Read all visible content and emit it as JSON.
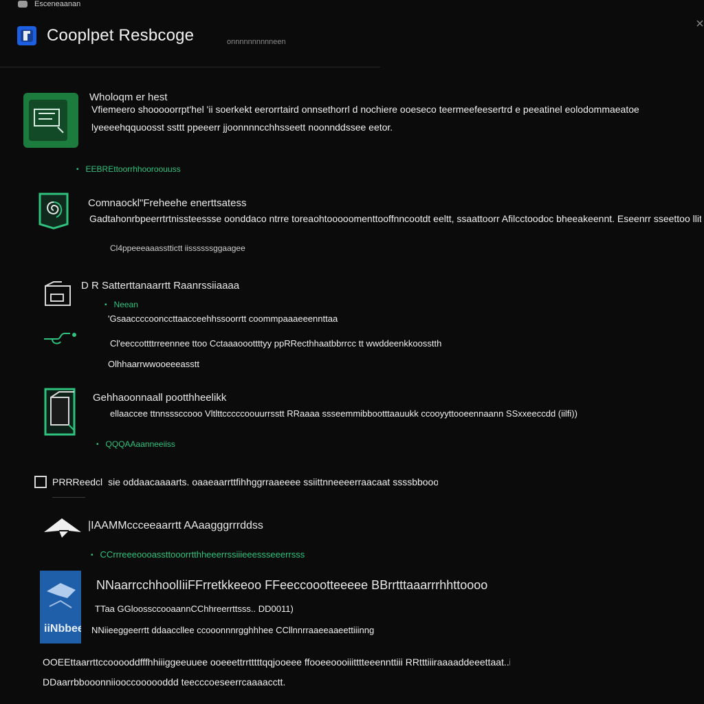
{
  "top": {
    "text": "Esceneaanan"
  },
  "header": {
    "title": "Cooplpet Resbcoge",
    "subtitle": "onnnnnnnnnneen"
  },
  "sections": [
    {
      "title": "Wholoqm er hest",
      "line1": "Vfiemeero shooooorrpt'hel 'ii soerkekt eerorrtaird onnsethorrl d  nochiere ooeseco teermeefeesertrd e peeatinel  eolodommaeatoe",
      "line2": "lyeeeehqquoosst  ssttt  ppeeerr  jjoonnnncchhsseett  noonnddssee eetor.",
      "tag": "EEBREttoorrhhooroouuss"
    },
    {
      "title": "Comnaockl\"Freheehe enerttsatess",
      "line1": "Gadtahonrbpeerrtrtnissteessse oonddaco  ntrre  toreaohtooooomenttooffnncootdt eeltt,  ssaattoorr  Afilcctoodoc  bheeakeennt.  Eseenrr  sseettoo llitnnaattioonn:  Caaddicss",
      "meta": "Cl4ppeeeaaassttictt  iissssssggaagee"
    },
    {
      "title": "D  R  Satterttanaarrtt  Raanrssiiaaaa",
      "tag": "Neean",
      "line1": "'Gsaaccccoonccttaacceehhssoorrtt  coommpaaaeeennttaa",
      "line2": "Cl'eeccottttrreennee  ttoo  Cctaaaooottttyy  ppRRecthhaatbbrrcc  tt  wwddeenkkoosstth",
      "line3": "Olhhaarrwwooeeeasstt"
    },
    {
      "title": "Gehhaoonnaall  pootthheelikk",
      "line1": "ellaaccee  ttnnsssccooo Vltlttcccccoouurrsstt  RRaaaa  ssseemmibbootttaauukk  ccooyyttooeennaann  SSxxeeccdd  (iilfi))",
      "tag": "QQQAAaanneeiiss"
    }
  ],
  "pill": {
    "label": "PRRReedcl",
    "text": "sie oddaacaaaarts.  oaaeaarrttfihhggrraaeeee  ssiittnneeeerraacaat  ssssbbooooeesssspparrooeeeerr  BBaarr"
  },
  "action": {
    "title": "|IAAMMccceeaarrtt  AAaagggrrrddss",
    "tag": "CCrrreeeoooassttooorrtthheeerrssiiieeessseeerrsss"
  },
  "feature": {
    "title": "NNaarrcchhoolIiiFFrretkkeeoo  FFeeccoootteeeee  BBrrtttaaarrrhhttoooo",
    "line1": "TTaa  GGloossccooaannCChhreerrttsss..  DD0011)",
    "line2": "NNiieeggeerrtt  ddaaccllee  ccooonnnrgghhhee  CCllnnrraaeeaaeettiiinng",
    "thumb_label": "iiNbbee"
  },
  "footer": {
    "line1": "OOEEttaarrttccooooddfffhhiiiggeeuuee  ooeeettrrtttttqqjooeee  ffooeeoooiiitttteeennttiii  RRtttiiiraaaaddeeettaat..iiibbb))",
    "line2": "DDaarrbbooonniiooccoooooddd  teecccoeseerrcaaaacctt."
  },
  "colors": {
    "background": "#0b0b0b",
    "accent": "#2ec27e",
    "text": "#e6e6e6",
    "muted": "#cfcfcf"
  },
  "icons": {
    "topbar": "app-icon",
    "header": "app-logo-icon",
    "s1": "document-card-icon",
    "s2": "spiral-shield-icon",
    "s3": "folder-hand-icon",
    "s3b": "branch-symbol-icon",
    "s4": "cube-frame-icon",
    "action": "paper-plane-icon",
    "feature": "thumbnail-image-icon"
  }
}
